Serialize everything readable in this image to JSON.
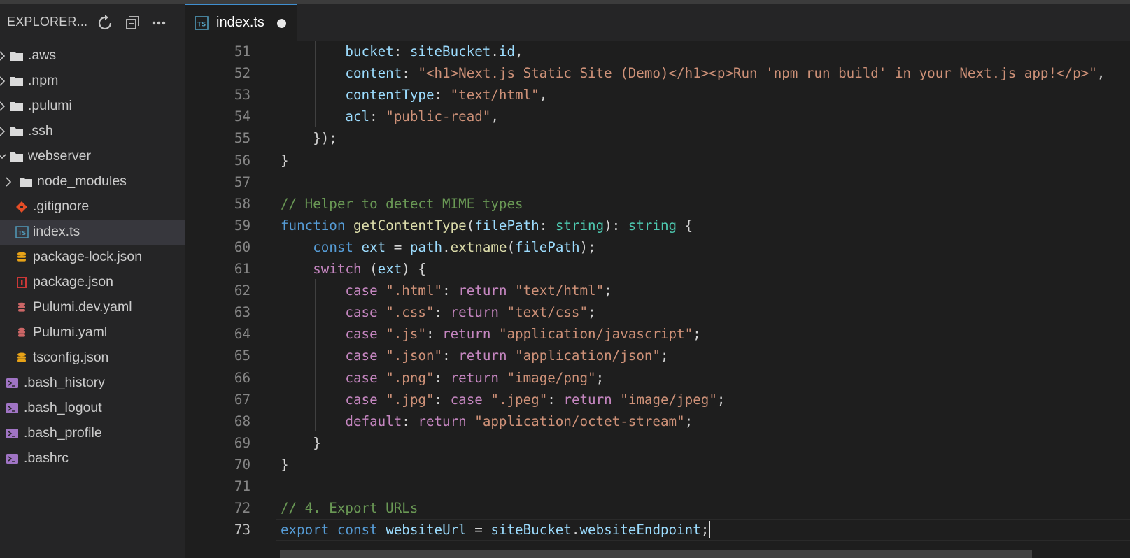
{
  "sidebar": {
    "title": "EXPLORER...",
    "icons": [
      "refresh-icon",
      "collapse-all-icon",
      "more-icon"
    ],
    "items": [
      {
        "label": ".aws",
        "kind": "folder"
      },
      {
        "label": ".npm",
        "kind": "folder"
      },
      {
        "label": ".pulumi",
        "kind": "folder"
      },
      {
        "label": ".ssh",
        "kind": "folder"
      },
      {
        "label": "webserver",
        "kind": "folder-open"
      },
      {
        "label": "node_modules",
        "kind": "folder"
      },
      {
        "label": ".gitignore",
        "kind": "git"
      },
      {
        "label": "index.ts",
        "kind": "typescript",
        "selected": true
      },
      {
        "label": "package-lock.json",
        "kind": "database"
      },
      {
        "label": "package.json",
        "kind": "npm"
      },
      {
        "label": "Pulumi.dev.yaml",
        "kind": "yaml"
      },
      {
        "label": "Pulumi.yaml",
        "kind": "yaml"
      },
      {
        "label": "tsconfig.json",
        "kind": "database"
      },
      {
        "label": ".bash_history",
        "kind": "shell"
      },
      {
        "label": ".bash_logout",
        "kind": "shell"
      },
      {
        "label": ".bash_profile",
        "kind": "shell"
      },
      {
        "label": ".bashrc",
        "kind": "shell"
      }
    ]
  },
  "tab": {
    "label": "index.ts",
    "icon_text": "TS",
    "dirty": true
  },
  "editor": {
    "current_line": 73,
    "lines": [
      {
        "n": "51",
        "tokens": [
          [
            "            ",
            "plain"
          ],
          [
            "bucket",
            "var"
          ],
          [
            ": ",
            "plain"
          ],
          [
            "siteBucket",
            "var"
          ],
          [
            ".",
            "plain"
          ],
          [
            "id",
            "var"
          ],
          [
            ",",
            "plain"
          ]
        ]
      },
      {
        "n": "52",
        "tokens": [
          [
            "            ",
            "plain"
          ],
          [
            "content",
            "var"
          ],
          [
            ": ",
            "plain"
          ],
          [
            "\"<h1>Next.js Static Site (Demo)</h1><p>Run 'npm run build' in your Next.js app!</p>\"",
            "str"
          ],
          [
            ",",
            "plain"
          ]
        ]
      },
      {
        "n": "53",
        "tokens": [
          [
            "            ",
            "plain"
          ],
          [
            "contentType",
            "var"
          ],
          [
            ": ",
            "plain"
          ],
          [
            "\"text/html\"",
            "str"
          ],
          [
            ",",
            "plain"
          ]
        ]
      },
      {
        "n": "54",
        "tokens": [
          [
            "            ",
            "plain"
          ],
          [
            "acl",
            "var"
          ],
          [
            ": ",
            "plain"
          ],
          [
            "\"public-read\"",
            "str"
          ],
          [
            ",",
            "plain"
          ]
        ]
      },
      {
        "n": "55",
        "tokens": [
          [
            "        ",
            "plain"
          ],
          [
            "});",
            "plain"
          ]
        ]
      },
      {
        "n": "56",
        "tokens": [
          [
            "    ",
            "plain"
          ],
          [
            "}",
            "plain"
          ]
        ]
      },
      {
        "n": "57",
        "tokens": []
      },
      {
        "n": "58",
        "tokens": [
          [
            "    ",
            "plain"
          ],
          [
            "// Helper to detect MIME types",
            "com"
          ]
        ]
      },
      {
        "n": "59",
        "tokens": [
          [
            "    ",
            "plain"
          ],
          [
            "function",
            "kw"
          ],
          [
            " ",
            "plain"
          ],
          [
            "getContentType",
            "fn"
          ],
          [
            "(",
            "plain"
          ],
          [
            "filePath",
            "var"
          ],
          [
            ": ",
            "plain"
          ],
          [
            "string",
            "type"
          ],
          [
            "): ",
            "plain"
          ],
          [
            "string",
            "type"
          ],
          [
            " {",
            "plain"
          ]
        ]
      },
      {
        "n": "60",
        "tokens": [
          [
            "        ",
            "plain"
          ],
          [
            "const",
            "kw"
          ],
          [
            " ",
            "plain"
          ],
          [
            "ext",
            "var"
          ],
          [
            " = ",
            "plain"
          ],
          [
            "path",
            "var"
          ],
          [
            ".",
            "plain"
          ],
          [
            "extname",
            "fn"
          ],
          [
            "(",
            "plain"
          ],
          [
            "filePath",
            "var"
          ],
          [
            ");",
            "plain"
          ]
        ]
      },
      {
        "n": "61",
        "tokens": [
          [
            "        ",
            "plain"
          ],
          [
            "switch",
            "ctl"
          ],
          [
            " (",
            "plain"
          ],
          [
            "ext",
            "var"
          ],
          [
            ") {",
            "plain"
          ]
        ]
      },
      {
        "n": "62",
        "tokens": [
          [
            "            ",
            "plain"
          ],
          [
            "case",
            "ctl"
          ],
          [
            " ",
            "plain"
          ],
          [
            "\".html\"",
            "str"
          ],
          [
            ": ",
            "plain"
          ],
          [
            "return",
            "ctl"
          ],
          [
            " ",
            "plain"
          ],
          [
            "\"text/html\"",
            "str"
          ],
          [
            ";",
            "plain"
          ]
        ]
      },
      {
        "n": "63",
        "tokens": [
          [
            "            ",
            "plain"
          ],
          [
            "case",
            "ctl"
          ],
          [
            " ",
            "plain"
          ],
          [
            "\".css\"",
            "str"
          ],
          [
            ": ",
            "plain"
          ],
          [
            "return",
            "ctl"
          ],
          [
            " ",
            "plain"
          ],
          [
            "\"text/css\"",
            "str"
          ],
          [
            ";",
            "plain"
          ]
        ]
      },
      {
        "n": "64",
        "tokens": [
          [
            "            ",
            "plain"
          ],
          [
            "case",
            "ctl"
          ],
          [
            " ",
            "plain"
          ],
          [
            "\".js\"",
            "str"
          ],
          [
            ": ",
            "plain"
          ],
          [
            "return",
            "ctl"
          ],
          [
            " ",
            "plain"
          ],
          [
            "\"application/javascript\"",
            "str"
          ],
          [
            ";",
            "plain"
          ]
        ]
      },
      {
        "n": "65",
        "tokens": [
          [
            "            ",
            "plain"
          ],
          [
            "case",
            "ctl"
          ],
          [
            " ",
            "plain"
          ],
          [
            "\".json\"",
            "str"
          ],
          [
            ": ",
            "plain"
          ],
          [
            "return",
            "ctl"
          ],
          [
            " ",
            "plain"
          ],
          [
            "\"application/json\"",
            "str"
          ],
          [
            ";",
            "plain"
          ]
        ]
      },
      {
        "n": "66",
        "tokens": [
          [
            "            ",
            "plain"
          ],
          [
            "case",
            "ctl"
          ],
          [
            " ",
            "plain"
          ],
          [
            "\".png\"",
            "str"
          ],
          [
            ": ",
            "plain"
          ],
          [
            "return",
            "ctl"
          ],
          [
            " ",
            "plain"
          ],
          [
            "\"image/png\"",
            "str"
          ],
          [
            ";",
            "plain"
          ]
        ]
      },
      {
        "n": "67",
        "tokens": [
          [
            "            ",
            "plain"
          ],
          [
            "case",
            "ctl"
          ],
          [
            " ",
            "plain"
          ],
          [
            "\".jpg\"",
            "str"
          ],
          [
            ": ",
            "plain"
          ],
          [
            "case",
            "ctl"
          ],
          [
            " ",
            "plain"
          ],
          [
            "\".jpeg\"",
            "str"
          ],
          [
            ": ",
            "plain"
          ],
          [
            "return",
            "ctl"
          ],
          [
            " ",
            "plain"
          ],
          [
            "\"image/jpeg\"",
            "str"
          ],
          [
            ";",
            "plain"
          ]
        ]
      },
      {
        "n": "68",
        "tokens": [
          [
            "            ",
            "plain"
          ],
          [
            "default",
            "ctl"
          ],
          [
            ": ",
            "plain"
          ],
          [
            "return",
            "ctl"
          ],
          [
            " ",
            "plain"
          ],
          [
            "\"application/octet-stream\"",
            "str"
          ],
          [
            ";",
            "plain"
          ]
        ]
      },
      {
        "n": "69",
        "tokens": [
          [
            "        ",
            "plain"
          ],
          [
            "}",
            "plain"
          ]
        ]
      },
      {
        "n": "70",
        "tokens": [
          [
            "    ",
            "plain"
          ],
          [
            "}",
            "plain"
          ]
        ]
      },
      {
        "n": "71",
        "tokens": []
      },
      {
        "n": "72",
        "tokens": [
          [
            "    ",
            "plain"
          ],
          [
            "// 4. Export URLs",
            "com"
          ]
        ]
      },
      {
        "n": "73",
        "tokens": [
          [
            "    ",
            "plain"
          ],
          [
            "export",
            "kw"
          ],
          [
            " ",
            "plain"
          ],
          [
            "const",
            "kw"
          ],
          [
            " ",
            "plain"
          ],
          [
            "websiteUrl",
            "var"
          ],
          [
            " = ",
            "plain"
          ],
          [
            "siteBucket",
            "var"
          ],
          [
            ".",
            "plain"
          ],
          [
            "websiteEndpoint",
            "var"
          ],
          [
            ";",
            "plain"
          ]
        ]
      }
    ]
  },
  "colors": {
    "sidebar_bg": "#252526",
    "editor_bg": "#1e1e1e",
    "selected_row": "#37373d",
    "tab_accent": "#3f8fd0",
    "folder_icon": "#dadada",
    "typescript_icon": "#519aba",
    "git_icon": "#e44d26",
    "database_icon": "#e8a317",
    "npm_icon": "#cb3837",
    "yaml_icon": "#cc6666",
    "shell_icon": "#a074c4"
  }
}
